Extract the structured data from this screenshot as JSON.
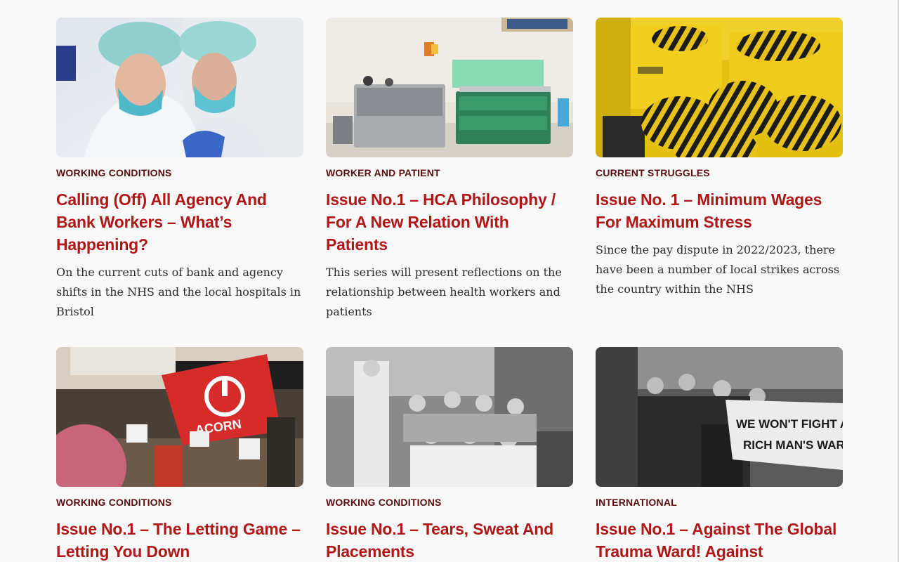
{
  "cards": [
    {
      "category": "WORKING CONDITIONS",
      "title": "Calling (Off) All Agency And Bank Workers – What’s Happening?",
      "excerpt": "On the current cuts of bank and agency shifts in the NHS and the local hospitals in Bristol"
    },
    {
      "category": "WORKER AND PATIENT",
      "title": "Issue No.1 – HCA Philosophy / For A New Relation With Patients",
      "excerpt": "This series will present reflections on the relationship between health workers and patients"
    },
    {
      "category": "CURRENT STRUGGLES",
      "title": "Issue No. 1 – Minimum Wages For Maximum Stress",
      "excerpt": "Since the pay dispute in 2022/2023, there have been a number of local strikes across the country within the NHS"
    },
    {
      "category": "WORKING CONDITIONS",
      "title": "Issue No.1 – The Letting Game – Letting You Down",
      "excerpt": ""
    },
    {
      "category": "WORKING CONDITIONS",
      "title": "Issue No.1 – Tears, Sweat And Placements",
      "excerpt": ""
    },
    {
      "category": "INTERNATIONAL",
      "title": "Issue No.1 – Against The Global Trauma Ward! Against",
      "excerpt": ""
    }
  ],
  "image_text": {
    "acorn_flag": "ACORN",
    "banner_line1": "WE WON'T FIGHT ANOTH",
    "banner_line2": "RICH MAN'S WAR!!!"
  },
  "colors": {
    "category": "#5a0d0d",
    "title": "#b01818",
    "excerpt": "#2c2c2c",
    "background": "#f9f9f9"
  }
}
